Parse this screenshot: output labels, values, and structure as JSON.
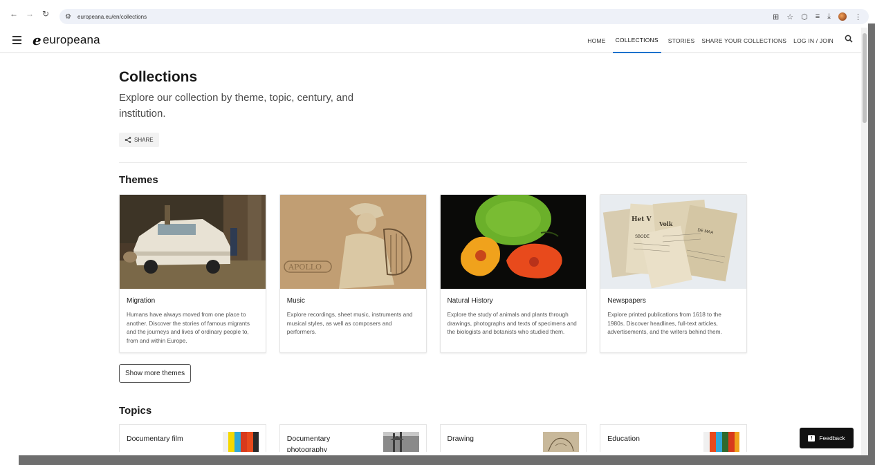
{
  "browser": {
    "url": "europeana.eu/en/collections"
  },
  "header": {
    "logo_text": "europeana",
    "nav": [
      {
        "label": "HOME",
        "active": false
      },
      {
        "label": "COLLECTIONS",
        "active": true
      },
      {
        "label": "STORIES",
        "active": false
      },
      {
        "label": "SHARE YOUR COLLECTIONS",
        "active": false
      },
      {
        "label": "LOG IN / JOIN",
        "active": false
      }
    ]
  },
  "page": {
    "title": "Collections",
    "description": "Explore our collection by theme, topic, century, and institution.",
    "share_label": "SHARE"
  },
  "themes": {
    "heading": "Themes",
    "cards": [
      {
        "title": "Migration",
        "text": "Humans have always moved from one place to another. Discover the stories of famous migrants and the journeys and lives of ordinary people to, from and within Europe."
      },
      {
        "title": "Music",
        "text": "Explore recordings, sheet music, instruments and musical styles, as well as composers and performers."
      },
      {
        "title": "Natural History",
        "text": "Explore the study of animals and plants through drawings, photographs and texts of specimens and the biologists and botanists who studied them."
      },
      {
        "title": "Newspapers",
        "text": "Explore printed publications from 1618 to the 1980s. Discover headlines, full-text articles, advertisements, and the writers behind them."
      }
    ],
    "more_label": "Show more themes"
  },
  "topics": {
    "heading": "Topics",
    "cards": [
      {
        "title": "Documentary film"
      },
      {
        "title": "Documentary photography"
      },
      {
        "title": "Drawing"
      },
      {
        "title": "Education"
      }
    ]
  },
  "feedback_label": "Feedback"
}
